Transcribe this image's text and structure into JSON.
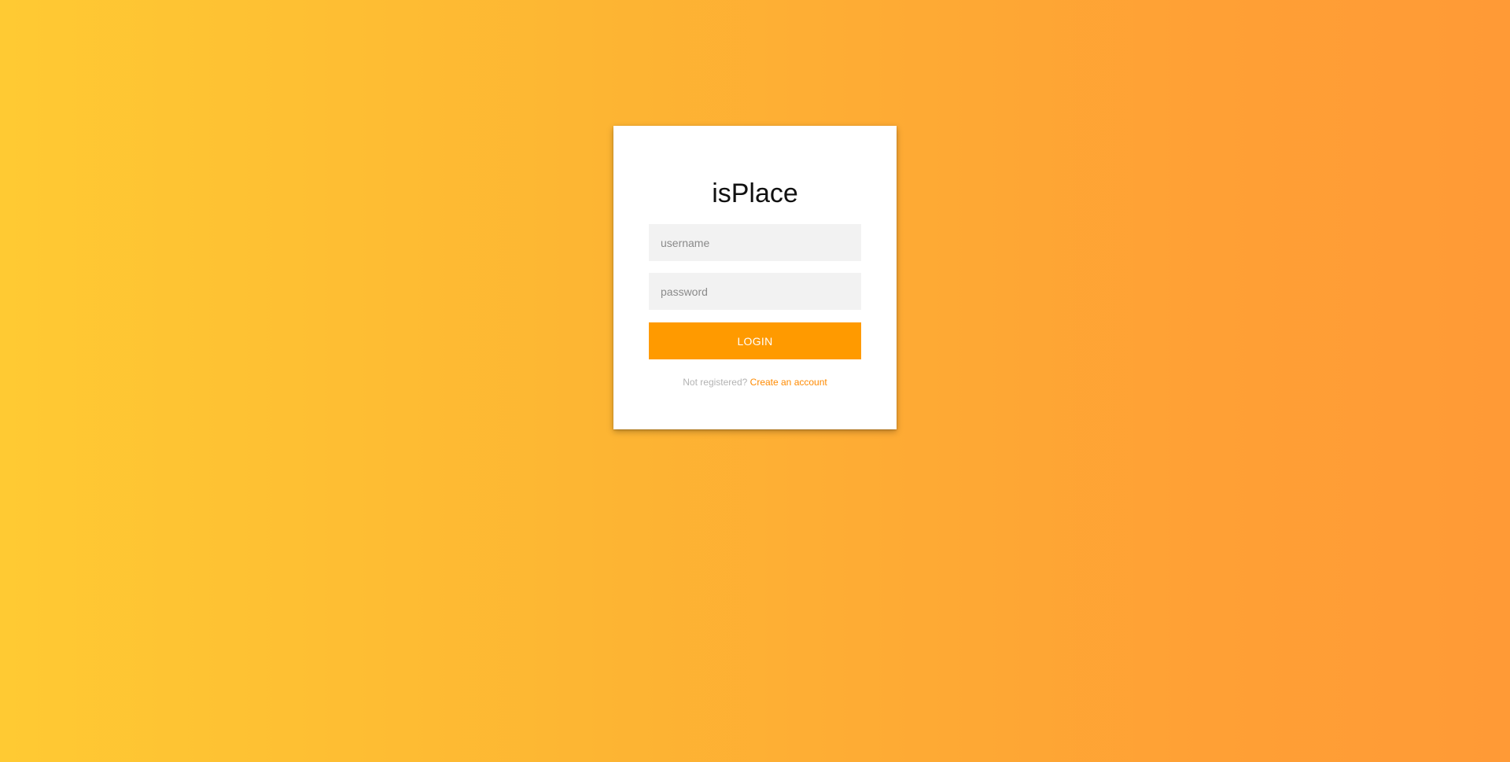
{
  "app": {
    "title": "isPlace"
  },
  "form": {
    "username_placeholder": "username",
    "username_value": "",
    "password_placeholder": "password",
    "password_value": "",
    "login_label": "LOGIN",
    "not_registered_text": "Not registered?",
    "create_account_link": "Create an account"
  },
  "colors": {
    "background_gradient_start": "#ffca33",
    "background_gradient_end": "#ff9a36",
    "card_background": "#ffffff",
    "field_background": "#f2f2f2",
    "button_background": "#ff9a00",
    "button_text": "#ffffff",
    "link_color": "#ff8a00",
    "muted_text": "#b3b3b3"
  }
}
